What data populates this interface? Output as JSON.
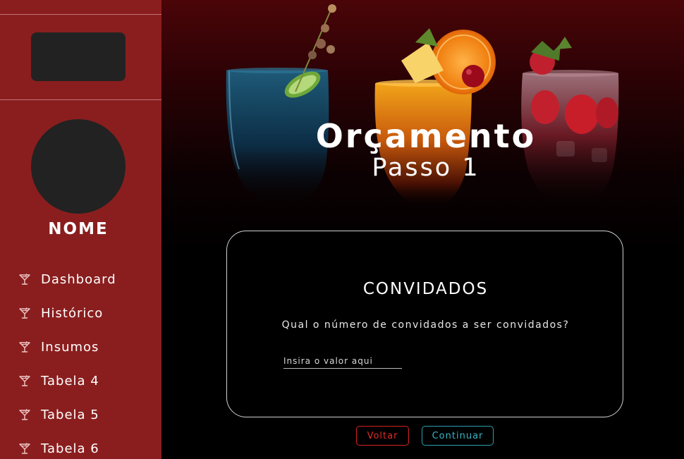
{
  "sidebar": {
    "user_name": "NOME",
    "items": [
      {
        "label": "Dashboard",
        "icon": "cocktail-glass-icon"
      },
      {
        "label": "Histórico",
        "icon": "cocktail-glass-icon"
      },
      {
        "label": "Insumos",
        "icon": "cocktail-glass-icon"
      },
      {
        "label": "Tabela 4",
        "icon": "cocktail-glass-icon"
      },
      {
        "label": "Tabela 5",
        "icon": "cocktail-glass-icon"
      },
      {
        "label": "Tabela 6",
        "icon": "cocktail-glass-icon"
      }
    ]
  },
  "header": {
    "title": "Orçamento",
    "subtitle": "Passo 1"
  },
  "card": {
    "heading": "CONVIDADOS",
    "question": "Qual o número de convidados a ser convidados?",
    "input_placeholder": "Insira o valor aqui",
    "input_value": ""
  },
  "actions": {
    "back_label": "Voltar",
    "continue_label": "Continuar"
  },
  "colors": {
    "sidebar_bg": "#8a1e1e",
    "back_button": "#e02a2a",
    "continue_button": "#35b4c6"
  }
}
